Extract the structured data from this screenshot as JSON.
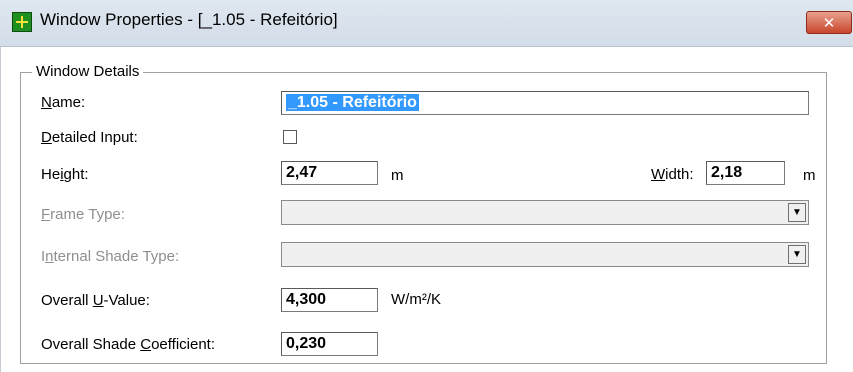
{
  "window": {
    "title": "Window Properties - [_1.05 - Refeitório]",
    "close_glyph": "✕"
  },
  "window_details": {
    "legend": "Window Details",
    "name": {
      "label_ul": "N",
      "label_rest": "ame:",
      "value": "_1.05 - Refeitório"
    },
    "detailed_input": {
      "label_ul": "D",
      "label_rest": "etailed Input:",
      "checked": false
    },
    "height": {
      "label_pre": "He",
      "label_ul": "i",
      "label_rest": "ght:",
      "value": "2,47",
      "unit": "m"
    },
    "width": {
      "label_ul": "W",
      "label_rest": "idth:",
      "value": "2,18",
      "unit": "m"
    },
    "frame_type": {
      "label_ul": "F",
      "label_rest": "rame Type:",
      "value": "",
      "enabled": false
    },
    "internal_shade_type": {
      "label_pre": "I",
      "label_ul": "n",
      "label_rest": "ternal Shade Type:",
      "value": "",
      "enabled": false
    },
    "overall_u_value": {
      "label_pre": "Overall ",
      "label_ul": "U",
      "label_rest": "-Value:",
      "value": "4,300",
      "unit": "W/m²/K"
    },
    "overall_shade_coefficient": {
      "label_pre": "Overall Shade ",
      "label_ul": "C",
      "label_rest": "oefficient:",
      "value": "0,230"
    },
    "dropdown_glyph": "▼"
  }
}
